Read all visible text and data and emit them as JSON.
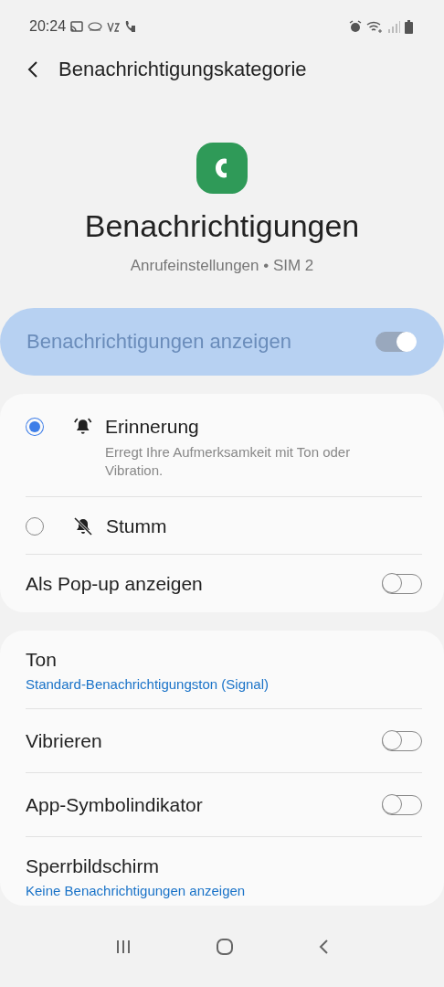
{
  "status_bar": {
    "time": "20:24"
  },
  "header": {
    "title": "Benachrichtigungskategorie"
  },
  "app": {
    "name": "Benachrichtigungen",
    "subtitle": "Anrufeinstellungen • SIM 2"
  },
  "master_switch": {
    "label": "Benachrichtigungen anzeigen",
    "on": true,
    "disabled": true
  },
  "cards": [
    {
      "items": [
        {
          "kind": "radio",
          "label": "Erinnerung",
          "description": "Erregt Ihre Aufmerksamkeit mit Ton oder Vibration.",
          "selected": true
        },
        {
          "kind": "radio",
          "label": "Stumm",
          "selected": false
        },
        {
          "kind": "switch",
          "label": "Als Pop-up anzeigen",
          "on": false
        }
      ]
    },
    {
      "items": [
        {
          "kind": "value",
          "label": "Ton",
          "value": "Standard-Benachrichtigungston (Signal)"
        },
        {
          "kind": "switch",
          "label": "Vibrieren",
          "on": false
        },
        {
          "kind": "switch",
          "label": "App-Symbolindikator",
          "on": false
        },
        {
          "kind": "value",
          "label": "Sperrbildschirm",
          "value": "Keine Benachrichtigungen anzeigen"
        }
      ]
    }
  ]
}
